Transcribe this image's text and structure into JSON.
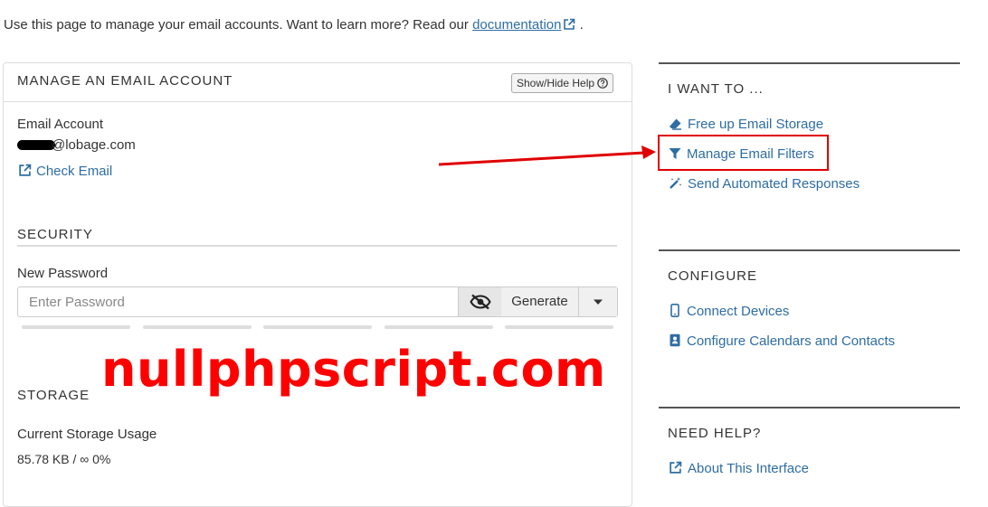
{
  "intro": {
    "text": "Use this page to manage your email accounts. Want to learn more? Read our ",
    "doc_link": "documentation",
    "suffix": "."
  },
  "panel": {
    "title": "MANAGE AN EMAIL ACCOUNT",
    "help_button": "Show/Hide Help",
    "email_account_label": "Email Account",
    "email_value": "@lobage.com",
    "check_email": "Check Email",
    "security_title": "SECURITY",
    "new_password_label": "New Password",
    "password_placeholder": "Enter Password",
    "generate_label": "Generate",
    "storage_title": "STORAGE",
    "storage_label": "Current Storage Usage",
    "storage_value": "85.78 KB / ∞ 0%"
  },
  "watermark": "nullphpscript.com",
  "sidebar": {
    "i_want_to": {
      "title": "I WANT TO ...",
      "links": [
        "Free up Email Storage",
        "Manage Email Filters",
        "Send Automated Responses"
      ]
    },
    "configure": {
      "title": "CONFIGURE",
      "links": [
        "Connect Devices",
        "Configure Calendars and Contacts"
      ]
    },
    "need_help": {
      "title": "NEED HELP?",
      "links": [
        "About This Interface"
      ]
    }
  },
  "icons": {
    "external": "external-link-icon",
    "question": "question-circle-icon",
    "eye_slash": "eye-slash-icon",
    "caret": "caret-down-icon",
    "eraser": "eraser-icon",
    "filter": "filter-icon",
    "magic": "magic-wand-icon",
    "mobile": "mobile-icon",
    "contacts": "address-book-icon"
  },
  "colors": {
    "link": "#2e6da4",
    "annotation": "#e00000",
    "border": "#dddddd"
  }
}
